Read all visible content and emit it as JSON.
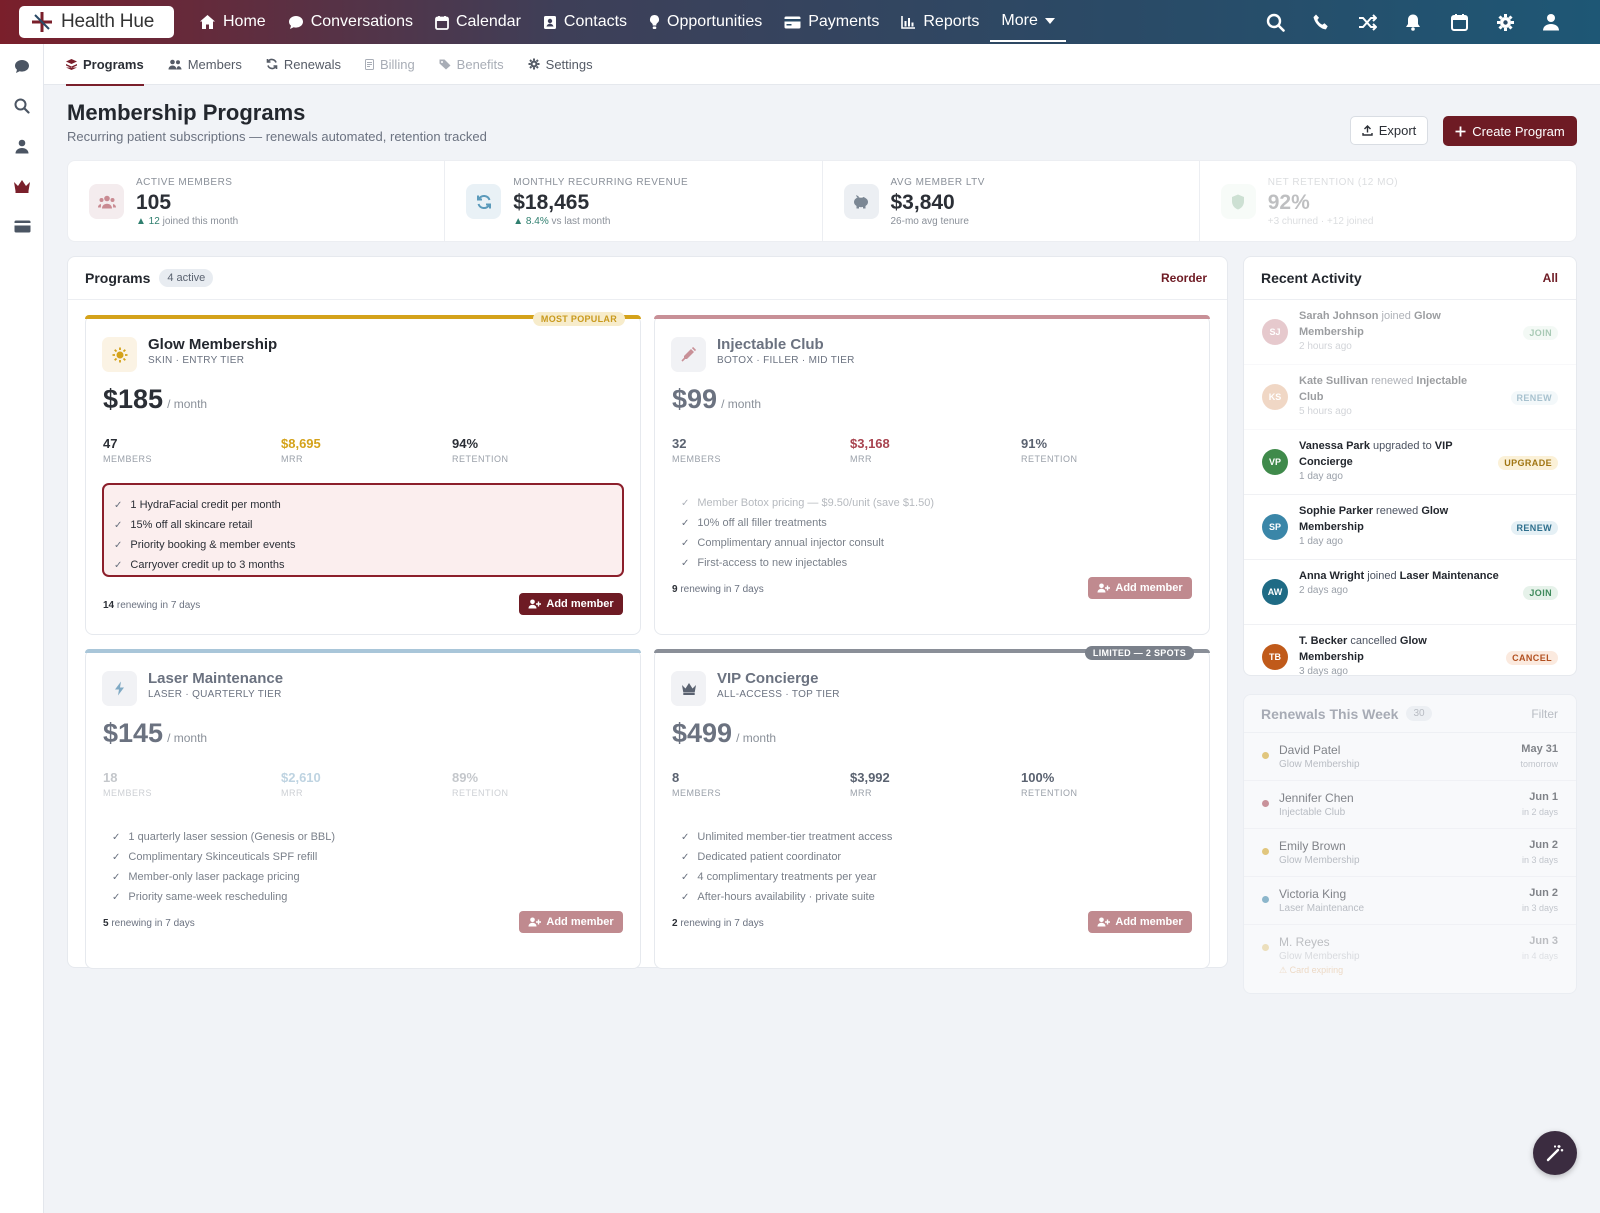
{
  "brand": {
    "name": "Health Hue"
  },
  "nav": {
    "items": [
      {
        "label": "Home",
        "icon": "home-icon"
      },
      {
        "label": "Conversations",
        "icon": "chat-icon"
      },
      {
        "label": "Calendar",
        "icon": "calendar-icon"
      },
      {
        "label": "Contacts",
        "icon": "contacts-icon"
      },
      {
        "label": "Opportunities",
        "icon": "lightbulb-icon"
      },
      {
        "label": "Payments",
        "icon": "credit-card-icon"
      },
      {
        "label": "Reports",
        "icon": "bar-chart-icon"
      }
    ],
    "more_label": "More",
    "right_icons": [
      "search-icon",
      "phone-icon",
      "shuffle-icon",
      "bell-icon",
      "calendar-icon",
      "gear-icon",
      "user-icon"
    ]
  },
  "rail": {
    "icons": [
      "chat-icon",
      "search-icon",
      "user-icon",
      "crown-icon",
      "credit-card-icon"
    ]
  },
  "subnav": {
    "tabs": [
      {
        "label": "Programs",
        "state": "active"
      },
      {
        "label": "Members",
        "state": "normal"
      },
      {
        "label": "Renewals",
        "state": "normal"
      },
      {
        "label": "Billing",
        "state": "disabled"
      },
      {
        "label": "Benefits",
        "state": "disabled"
      },
      {
        "label": "Settings",
        "state": "normal"
      }
    ]
  },
  "header": {
    "title": "Membership Programs",
    "subtitle": "Recurring patient subscriptions — renewals automated, retention tracked",
    "export_label": "Export",
    "create_label": "Create Program"
  },
  "stats": [
    {
      "label": "ACTIVE MEMBERS",
      "value": "105",
      "note_strong": "▲ 12",
      "note": "joined this month",
      "icon": "users-icon"
    },
    {
      "label": "MONTHLY RECURRING REVENUE",
      "value": "$18,465",
      "note_strong": "▲ 8.4%",
      "note": "vs last month",
      "icon": "refresh-icon"
    },
    {
      "label": "AVG MEMBER LTV",
      "value": "$3,840",
      "note_strong": "",
      "note": "26-mo avg tenure",
      "icon": "piggy-bank-icon"
    },
    {
      "label": "NET RETENTION (12 MO)",
      "value": "92%",
      "note_strong": "",
      "note": "+3 churned · +12 joined",
      "icon": "shield-icon"
    }
  ],
  "programs": {
    "title": "Programs",
    "badge": "4 active",
    "reorder_label": "Reorder",
    "add_label": "Add member",
    "renewing_suffix": "renewing in 7 days",
    "cards": [
      {
        "name": "Glow Membership",
        "tier": "SKIN · ENTRY TIER",
        "price": "$185",
        "per": "/ month",
        "ribbon": "MOST POPULAR",
        "accent": "#d4a21a",
        "icon": "sun-icon",
        "members": "47",
        "mrr": "$8,695",
        "retention": "94%",
        "labels": {
          "members": "MEMBERS",
          "mrr": "MRR",
          "retention": "RETENTION"
        },
        "benefits": [
          "1 HydraFacial credit per month",
          "15% off all skincare retail",
          "Priority booking & member events",
          "Carryover credit up to 3 months"
        ],
        "renewing": "14"
      },
      {
        "name": "Injectable Club",
        "tier": "BOTOX · FILLER · MID TIER",
        "price": "$99",
        "per": "/ month",
        "ribbon": "",
        "accent": "#c89097",
        "icon": "syringe-icon",
        "members": "32",
        "mrr": "$3,168",
        "retention": "91%",
        "labels": {
          "members": "MEMBERS",
          "mrr": "MRR",
          "retention": "RETENTION"
        },
        "benefits": [
          "Member Botox pricing — $9.50/unit (save $1.50)",
          "10% off all filler treatments",
          "Complimentary annual injector consult",
          "First-access to new injectables"
        ],
        "renewing": "9"
      },
      {
        "name": "Laser Maintenance",
        "tier": "LASER · QUARTERLY TIER",
        "price": "$145",
        "per": "/ month",
        "ribbon": "",
        "accent": "#a9c6d9",
        "icon": "bolt-icon",
        "members": "18",
        "mrr": "$2,610",
        "retention": "89%",
        "labels": {
          "members": "MEMBERS",
          "mrr": "MRR",
          "retention": "RETENTION"
        },
        "benefits": [
          "1 quarterly laser session (Genesis or BBL)",
          "Complimentary Skinceuticals SPF refill",
          "Member-only laser package pricing",
          "Priority same-week rescheduling"
        ],
        "renewing": "5"
      },
      {
        "name": "VIP Concierge",
        "tier": "ALL-ACCESS · TOP TIER",
        "price": "$499",
        "per": "/ month",
        "ribbon": "LIMITED — 2 SPOTS",
        "accent": "#8a8f98",
        "icon": "crown-icon",
        "members": "8",
        "mrr": "$3,992",
        "retention": "100%",
        "labels": {
          "members": "MEMBERS",
          "mrr": "MRR",
          "retention": "RETENTION"
        },
        "benefits": [
          "Unlimited member-tier treatment access",
          "Dedicated patient coordinator",
          "4 complimentary treatments per year",
          "After-hours availability · private suite"
        ],
        "renewing": "2"
      }
    ]
  },
  "activity": {
    "title": "Recent Activity",
    "all_label": "All",
    "items": [
      {
        "initials": "SJ",
        "color": "#c98a92",
        "name": "Sarah Johnson",
        "verb": "joined",
        "target": "Glow Membership",
        "time": "2 hours ago",
        "tag": "JOIN",
        "tag_bg": "#e6f2ea",
        "tag_fg": "#3e8a5b"
      },
      {
        "initials": "KS",
        "color": "#e0a781",
        "name": "Kate Sullivan",
        "verb": "renewed",
        "target": "Injectable Club",
        "time": "5 hours ago",
        "tag": "RENEW",
        "tag_bg": "#e5f0f5",
        "tag_fg": "#3d7895"
      },
      {
        "initials": "VP",
        "color": "#3f8a4b",
        "name": "Vanessa Park",
        "verb": "upgraded to",
        "target": "VIP Concierge",
        "time": "1 day ago",
        "tag": "UPGRADE",
        "tag_bg": "#fbf1d8",
        "tag_fg": "#a07512"
      },
      {
        "initials": "SP",
        "color": "#3a86a8",
        "name": "Sophie Parker",
        "verb": "renewed",
        "target": "Glow Membership",
        "time": "1 day ago",
        "tag": "RENEW",
        "tag_bg": "#e5f0f5",
        "tag_fg": "#2e6f8d"
      },
      {
        "initials": "AW",
        "color": "#1f6b85",
        "name": "Anna Wright",
        "verb": "joined",
        "target": "Laser Maintenance",
        "time": "2 days ago",
        "tag": "JOIN",
        "tag_bg": "#e6f2ea",
        "tag_fg": "#3e8a5b"
      },
      {
        "initials": "TB",
        "color": "#c05a1a",
        "name": "T. Becker",
        "verb": "cancelled",
        "target": "Glow Membership",
        "time": "3 days ago",
        "tag": "CANCEL",
        "tag_bg": "#fbeadf",
        "tag_fg": "#b25020"
      }
    ]
  },
  "renewals": {
    "title": "Renewals This Week",
    "count": "30",
    "filter_label": "Filter",
    "items": [
      {
        "name": "David Patel",
        "program": "Glow Membership",
        "date": "May 31",
        "rel": "tomorrow",
        "dot": "#d4a21a",
        "warn": ""
      },
      {
        "name": "Jennifer Chen",
        "program": "Injectable Club",
        "date": "Jun 1",
        "rel": "in 2 days",
        "dot": "#a8434f",
        "warn": ""
      },
      {
        "name": "Emily Brown",
        "program": "Glow Membership",
        "date": "Jun 2",
        "rel": "in 3 days",
        "dot": "#d4a21a",
        "warn": ""
      },
      {
        "name": "Victoria King",
        "program": "Laser Maintenance",
        "date": "Jun 2",
        "rel": "in 3 days",
        "dot": "#3a86a8",
        "warn": ""
      },
      {
        "name": "M. Reyes",
        "program": "Glow Membership",
        "date": "Jun 3",
        "rel": "in 4 days",
        "dot": "#d4a21a",
        "warn": "⚠ Card expiring"
      }
    ]
  }
}
